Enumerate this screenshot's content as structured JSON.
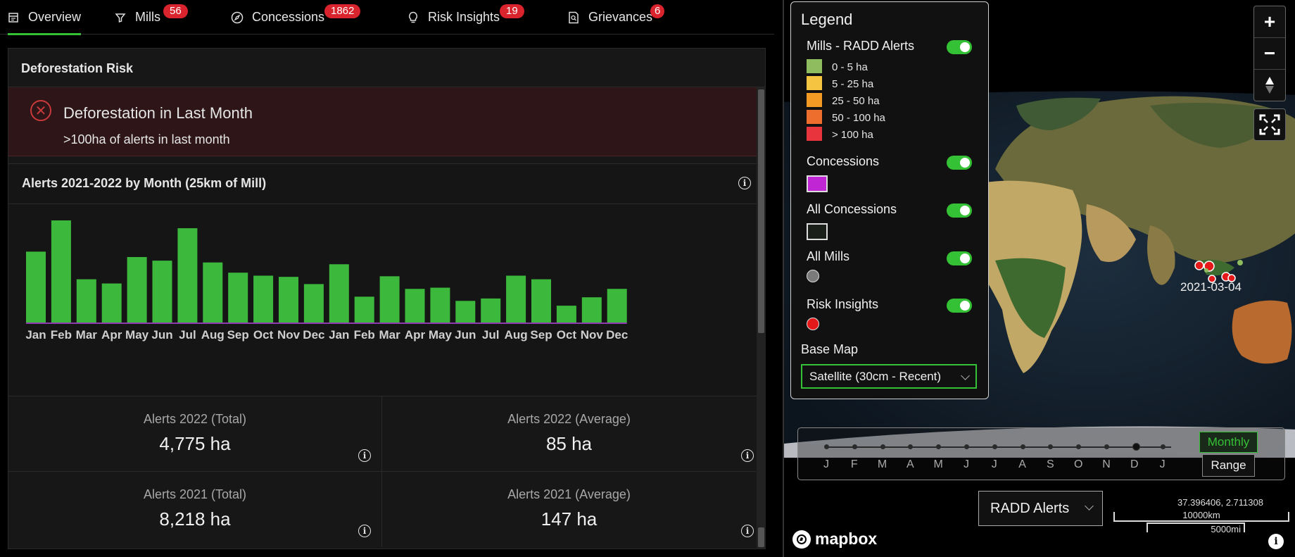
{
  "tabs": [
    {
      "label": "Overview",
      "icon": "calendar-icon",
      "badge": null
    },
    {
      "label": "Mills",
      "icon": "filter-icon",
      "badge": "56"
    },
    {
      "label": "Concessions",
      "icon": "compass-icon",
      "badge": "1862"
    },
    {
      "label": "Risk Insights",
      "icon": "lightbulb-icon",
      "badge": "19"
    },
    {
      "label": "Grievances",
      "icon": "report-search-icon",
      "badge": "6"
    }
  ],
  "card": {
    "title": "Deforestation Risk",
    "alert": {
      "title": "Deforestation in Last Month",
      "subtitle": ">100ha of alerts in last month"
    }
  },
  "chart_data": {
    "type": "bar",
    "title": "Alerts 2021-2022 by Month (25km of Mill)",
    "categories": [
      "Jan",
      "Feb",
      "Mar",
      "Apr",
      "May",
      "Jun",
      "Jul",
      "Aug",
      "Sep",
      "Oct",
      "Nov",
      "Dec",
      "Jan",
      "Feb",
      "Mar",
      "Apr",
      "May",
      "Jun",
      "Jul",
      "Aug",
      "Sep",
      "Oct",
      "Nov",
      "Dec"
    ],
    "series": [
      {
        "values": [
          118,
          170,
          72,
          65,
          109,
          103,
          157,
          100,
          83,
          78,
          76,
          64,
          97,
          43,
          77,
          56,
          58,
          36,
          40,
          78,
          72,
          28,
          42,
          56
        ],
        "color": "#3cb93c"
      }
    ],
    "ylim": [
      0,
      180
    ],
    "grid": false,
    "legend": "none"
  },
  "stats": [
    {
      "label": "Alerts 2022 (Total)",
      "value": "4,775 ha"
    },
    {
      "label": "Alerts 2022 (Average)",
      "value": "85 ha"
    },
    {
      "label": "Alerts 2021 (Total)",
      "value": "8,218 ha"
    },
    {
      "label": "Alerts 2021 (Average)",
      "value": "147 ha"
    }
  ],
  "legend": {
    "title": "Legend",
    "radd": {
      "title": "Mills - RADD Alerts",
      "items": [
        {
          "label": "0 - 5 ha",
          "color": "#8fbc5e"
        },
        {
          "label": "5 - 25 ha",
          "color": "#f5c542"
        },
        {
          "label": "25 - 50 ha",
          "color": "#f39a25"
        },
        {
          "label": "50 - 100 ha",
          "color": "#ee6e2d"
        },
        {
          "label": "> 100 ha",
          "color": "#e8353d"
        }
      ]
    },
    "concessions": {
      "title": "Concessions",
      "color": "#c026d3"
    },
    "all_concessions": {
      "title": "All Concessions"
    },
    "all_mills": {
      "title": "All Mills",
      "color": "#7a7a7a"
    },
    "risk_insights": {
      "title": "Risk Insights",
      "color": "#e51919"
    },
    "base_map_label": "Base Map",
    "base_map_value": "Satellite (30cm - Recent)"
  },
  "map": {
    "date_label": "2021-03-04",
    "timeline_months": [
      "J",
      "F",
      "M",
      "A",
      "M",
      "J",
      "J",
      "A",
      "S",
      "O",
      "N",
      "D",
      "J"
    ],
    "monthly_label": "Monthly",
    "range_label": "Range",
    "layer_value": "RADD Alerts",
    "coords": "37.396406, 2.711308",
    "scale_km": "10000km",
    "scale_mi": "5000mi",
    "logo_text": "mapbox"
  }
}
